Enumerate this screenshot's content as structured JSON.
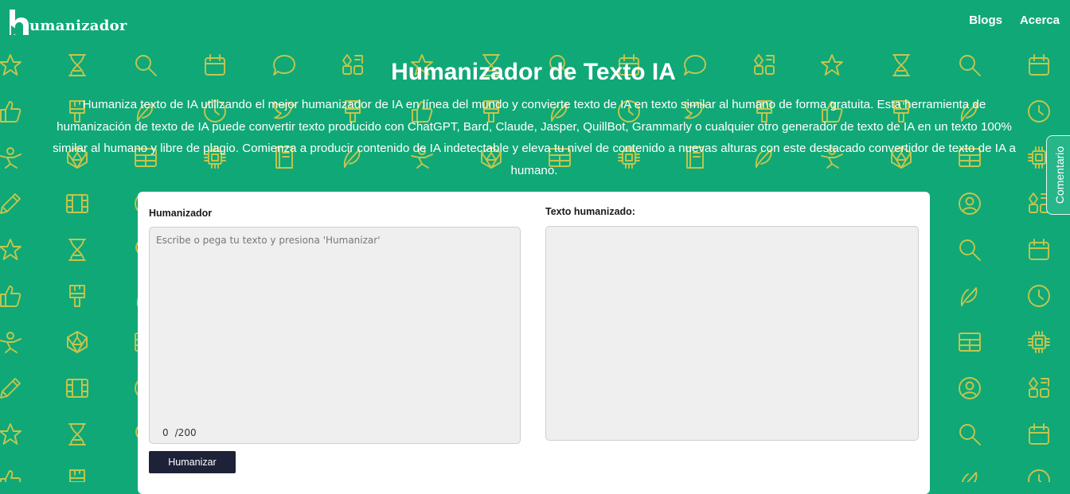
{
  "colors": {
    "brand_green": "#10a877",
    "pattern_icons": "#d6c84a",
    "button_dark": "#1e2238",
    "card_bg": "#ffffff",
    "field_bg": "#efefef"
  },
  "header": {
    "logo_text": "umanizador",
    "nav": [
      {
        "label": "Blogs"
      },
      {
        "label": "Acerca"
      }
    ]
  },
  "hero": {
    "title": "Humanizador de Texto IA",
    "description": "Humaniza texto de IA utilizando el mejor humanizador de IA en línea del mundo y convierte texto de IA en texto similar al humano de forma gratuita. Esta herramienta de humanización de texto de IA puede convertir texto producido con ChatGPT, Bard, Claude, Jasper, QuillBot, Grammarly o cualquier otro generador de texto de IA en un texto 100% similar al humano y libre de plagio. Comienza a producir contenido de IA indetectable y eleva tu nivel de contenido a nuevas alturas con este destacado convertidor de texto de IA a humano."
  },
  "tool": {
    "input_label": "Humanizador",
    "input_placeholder": "Escribe o pega tu texto y presiona 'Humanizar'",
    "input_value": "",
    "char_count": "0",
    "char_limit": "/200",
    "output_label": "Texto humanizado:",
    "output_value": "",
    "button_label": "Humanizar"
  },
  "feedback_tab": {
    "label": "Comentario"
  },
  "background_icons": [
    "star-icon",
    "hourglass-icon",
    "search-icon",
    "calendar-icon",
    "chat-icon",
    "apps-icon",
    "thumbs-up-icon",
    "brush-icon",
    "plant-icon",
    "clock-icon",
    "person-icon",
    "dice-icon",
    "table-icon",
    "chip-icon",
    "notebook-icon",
    "pen-icon",
    "film-icon",
    "user-circle-icon",
    "bird-icon"
  ]
}
